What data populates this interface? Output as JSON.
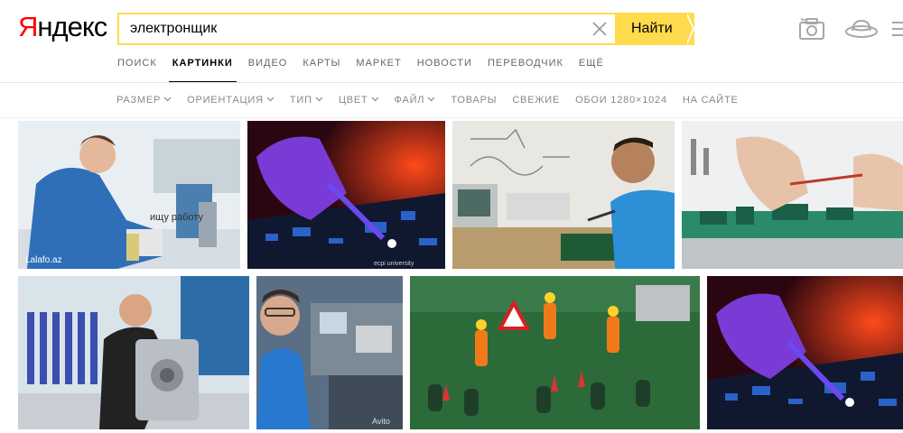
{
  "logo": {
    "first": "Я",
    "rest": "ндекс"
  },
  "search": {
    "query": "электронщик",
    "button_label": "Найти"
  },
  "nav": {
    "items": [
      {
        "label": "ПОИСК",
        "active": false
      },
      {
        "label": "КАРТИНКИ",
        "active": true
      },
      {
        "label": "ВИДЕО",
        "active": false
      },
      {
        "label": "КАРТЫ",
        "active": false
      },
      {
        "label": "МАРКЕТ",
        "active": false
      },
      {
        "label": "НОВОСТИ",
        "active": false
      },
      {
        "label": "ПЕРЕВОДЧИК",
        "active": false
      },
      {
        "label": "ЕЩЁ",
        "active": false
      }
    ]
  },
  "filters": {
    "items": [
      {
        "label": "РАЗМЕР",
        "dropdown": true
      },
      {
        "label": "ОРИЕНТАЦИЯ",
        "dropdown": true
      },
      {
        "label": "ТИП",
        "dropdown": true
      },
      {
        "label": "ЦВЕТ",
        "dropdown": true
      },
      {
        "label": "ФАЙЛ",
        "dropdown": true
      },
      {
        "label": "ТОВАРЫ",
        "dropdown": false
      },
      {
        "label": "СВЕЖИЕ",
        "dropdown": false
      },
      {
        "label": "ОБОИ 1280×1024",
        "dropdown": false
      },
      {
        "label": "НА САЙТЕ",
        "dropdown": false
      }
    ]
  },
  "results": [
    {
      "caption": "ищу работу",
      "watermark": "Lalafo.az"
    },
    {
      "caption": "",
      "watermark": "ecpi university"
    },
    {
      "caption": "",
      "watermark": ""
    },
    {
      "caption": "",
      "watermark": ""
    },
    {
      "caption": "",
      "watermark": ""
    },
    {
      "caption": "",
      "watermark": "Avito"
    },
    {
      "caption": "",
      "watermark": ""
    },
    {
      "caption": "",
      "watermark": ""
    }
  ],
  "colors": {
    "accent": "#ffdb4d",
    "logo_red": "#ff0000",
    "nav_text": "#666666",
    "filter_text": "#888888"
  }
}
